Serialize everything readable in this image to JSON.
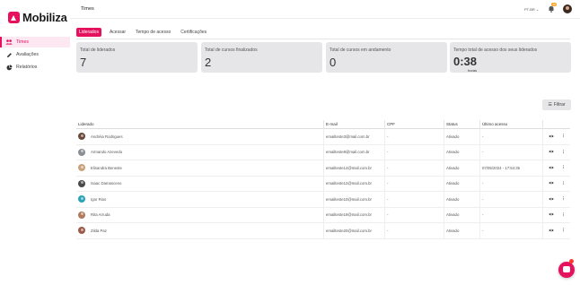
{
  "brand": {
    "name": "Mobiliza",
    "accent": "#e5105e"
  },
  "sidebar": {
    "items": [
      {
        "label": "Times",
        "icon": "team-icon",
        "active": true
      },
      {
        "label": "Avaliações",
        "icon": "pencil-icon",
        "active": false
      },
      {
        "label": "Relatórios",
        "icon": "pie-chart-icon",
        "active": false
      }
    ]
  },
  "header": {
    "title": "Times",
    "language": "PT-BR",
    "notifications_count": "10"
  },
  "tabs": [
    {
      "label": "Liderados",
      "active": true
    },
    {
      "label": "Acessar",
      "active": false
    },
    {
      "label": "Tempo de acesso",
      "active": false
    },
    {
      "label": "Certificações",
      "active": false
    }
  ],
  "stats": [
    {
      "label": "Total de liderados",
      "value": "7"
    },
    {
      "label": "Total de cursos finalizados",
      "value": "2"
    },
    {
      "label": "Total de cursos em andamento",
      "value": "0"
    },
    {
      "label": "Tempo total de acesso dos seus liderados",
      "value": "0:38",
      "unit": "horas"
    }
  ],
  "filter": {
    "label": "Filtrar"
  },
  "table": {
    "columns": [
      "Liderado",
      "E-mail",
      "CPF",
      "Status",
      "Último acesso"
    ],
    "rows": [
      {
        "name": "Andréia Rodrigues",
        "email": "emailteste3@mail.com.br",
        "cpf": "-",
        "status": "Ativado",
        "last": "-",
        "avatar": "#6b4a3a"
      },
      {
        "name": "Armando Azevedo",
        "email": "emailteste9@mail.com.br",
        "cpf": "-",
        "status": "Ativado",
        "last": "-",
        "avatar": "#8a8f96"
      },
      {
        "name": "Elisandra Beneste",
        "email": "emailteste14@mail.com.br",
        "cpf": "-",
        "status": "Ativado",
        "last": "07/05/2024 - 17:54:35",
        "avatar": "#c9a27a"
      },
      {
        "name": "Isaac Damasceno",
        "email": "emailteste12@mail.com.br",
        "cpf": "-",
        "status": "Ativado",
        "last": "-",
        "avatar": "#4a4a4a"
      },
      {
        "name": "Igor Rios",
        "email": "emailteste10@mail.com.br",
        "cpf": "-",
        "status": "Ativado",
        "last": "-",
        "avatar": "#2aa3b8"
      },
      {
        "name": "Rita Arruda",
        "email": "emailteste19@mail.com.br",
        "cpf": "-",
        "status": "Ativado",
        "last": "-",
        "avatar": "#b07a5c"
      },
      {
        "name": "Zilda Paz",
        "email": "emailteste20@mail.com.br",
        "cpf": "-",
        "status": "Ativado",
        "last": "-",
        "avatar": "#9c5b4a"
      }
    ]
  }
}
